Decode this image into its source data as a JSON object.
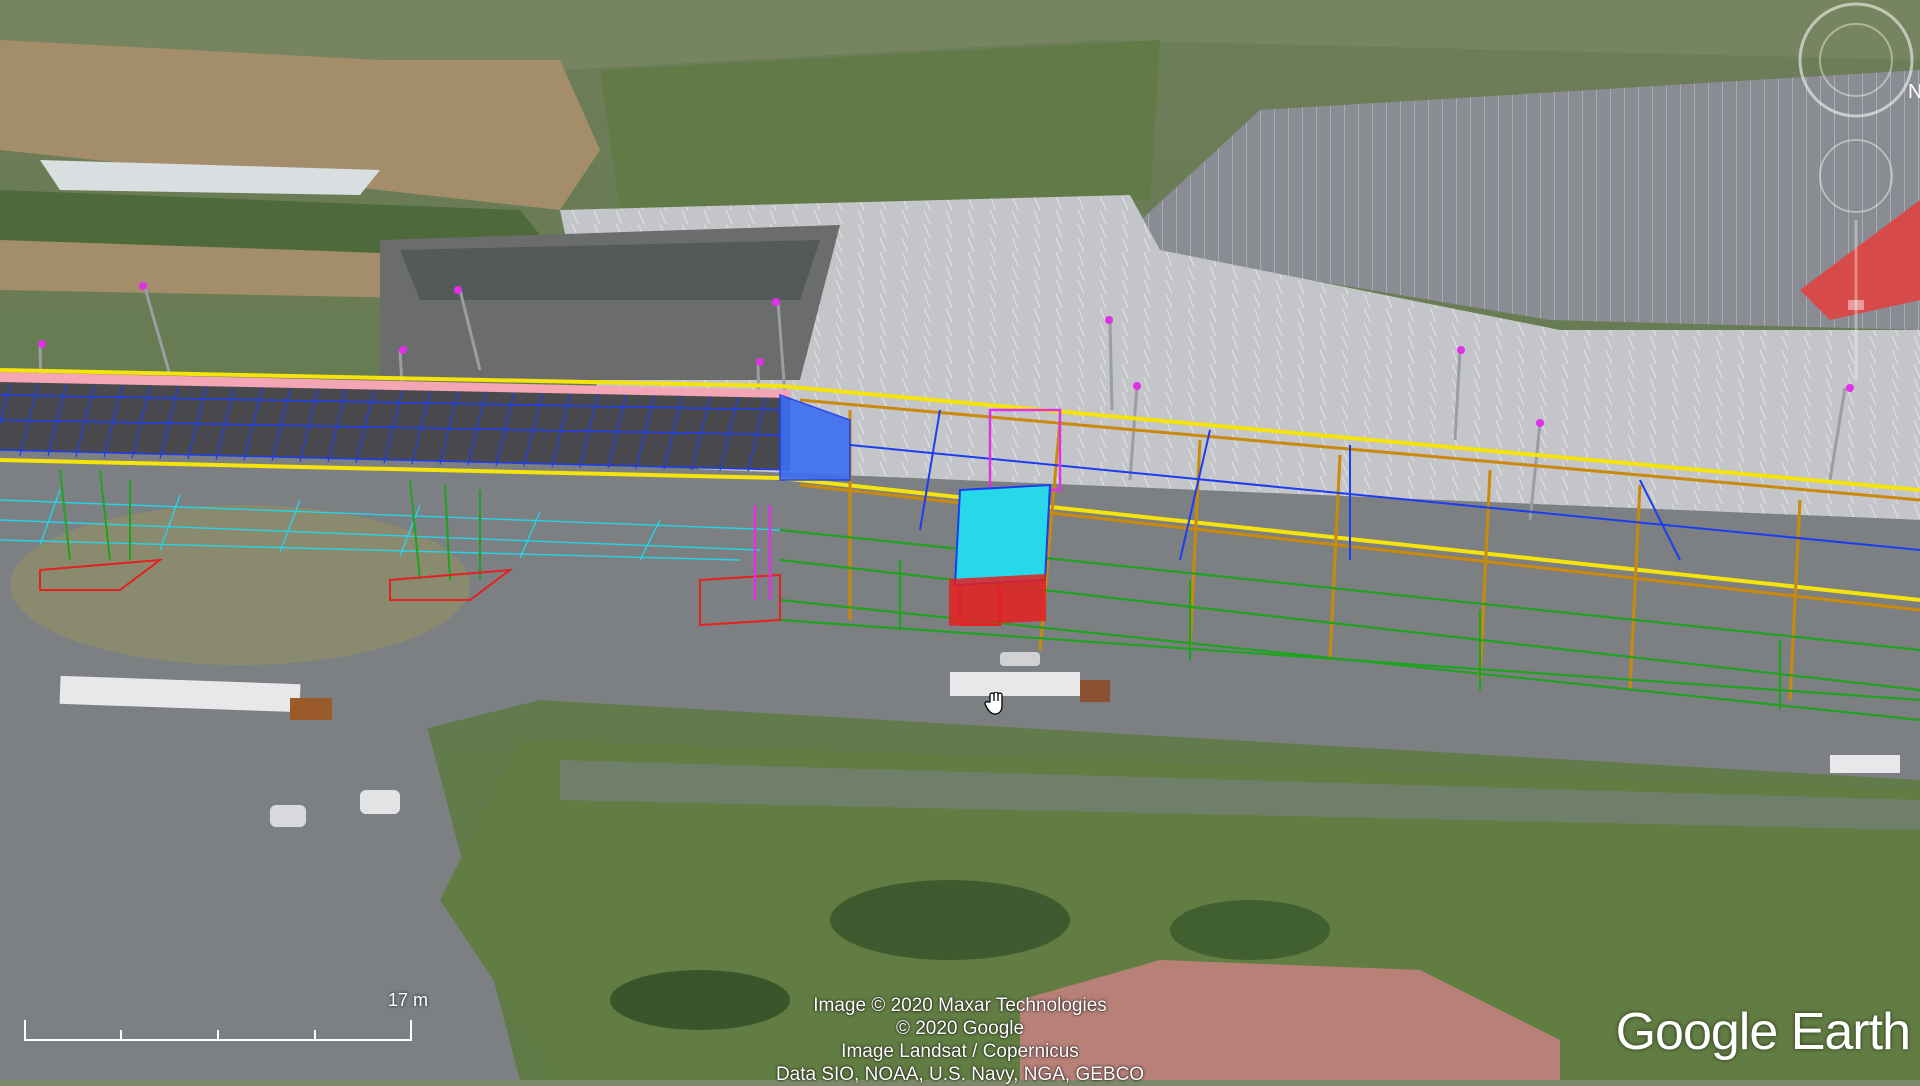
{
  "map": {
    "attribution": [
      "Image © 2020 Maxar Technologies",
      "© 2020 Google",
      "Image Landsat / Copernicus",
      "Data SIO, NOAA, U.S. Navy, NGA, GEBCO"
    ],
    "brand": "Google Earth",
    "scale_label": "17 m"
  },
  "icons": {
    "cursor": "hand-cursor-icon",
    "compass": "compass-icon",
    "zoom": "zoom-control-icon"
  },
  "colors": {
    "overlay_yellow": "#f4e40a",
    "overlay_blue": "#1c3cf0",
    "overlay_cyan": "#25d4e8",
    "overlay_green": "#1fa21f",
    "overlay_orange": "#c98a0a",
    "overlay_red": "#e62020",
    "overlay_magenta": "#e030e8",
    "overlay_pink": "#f4a6b4"
  }
}
